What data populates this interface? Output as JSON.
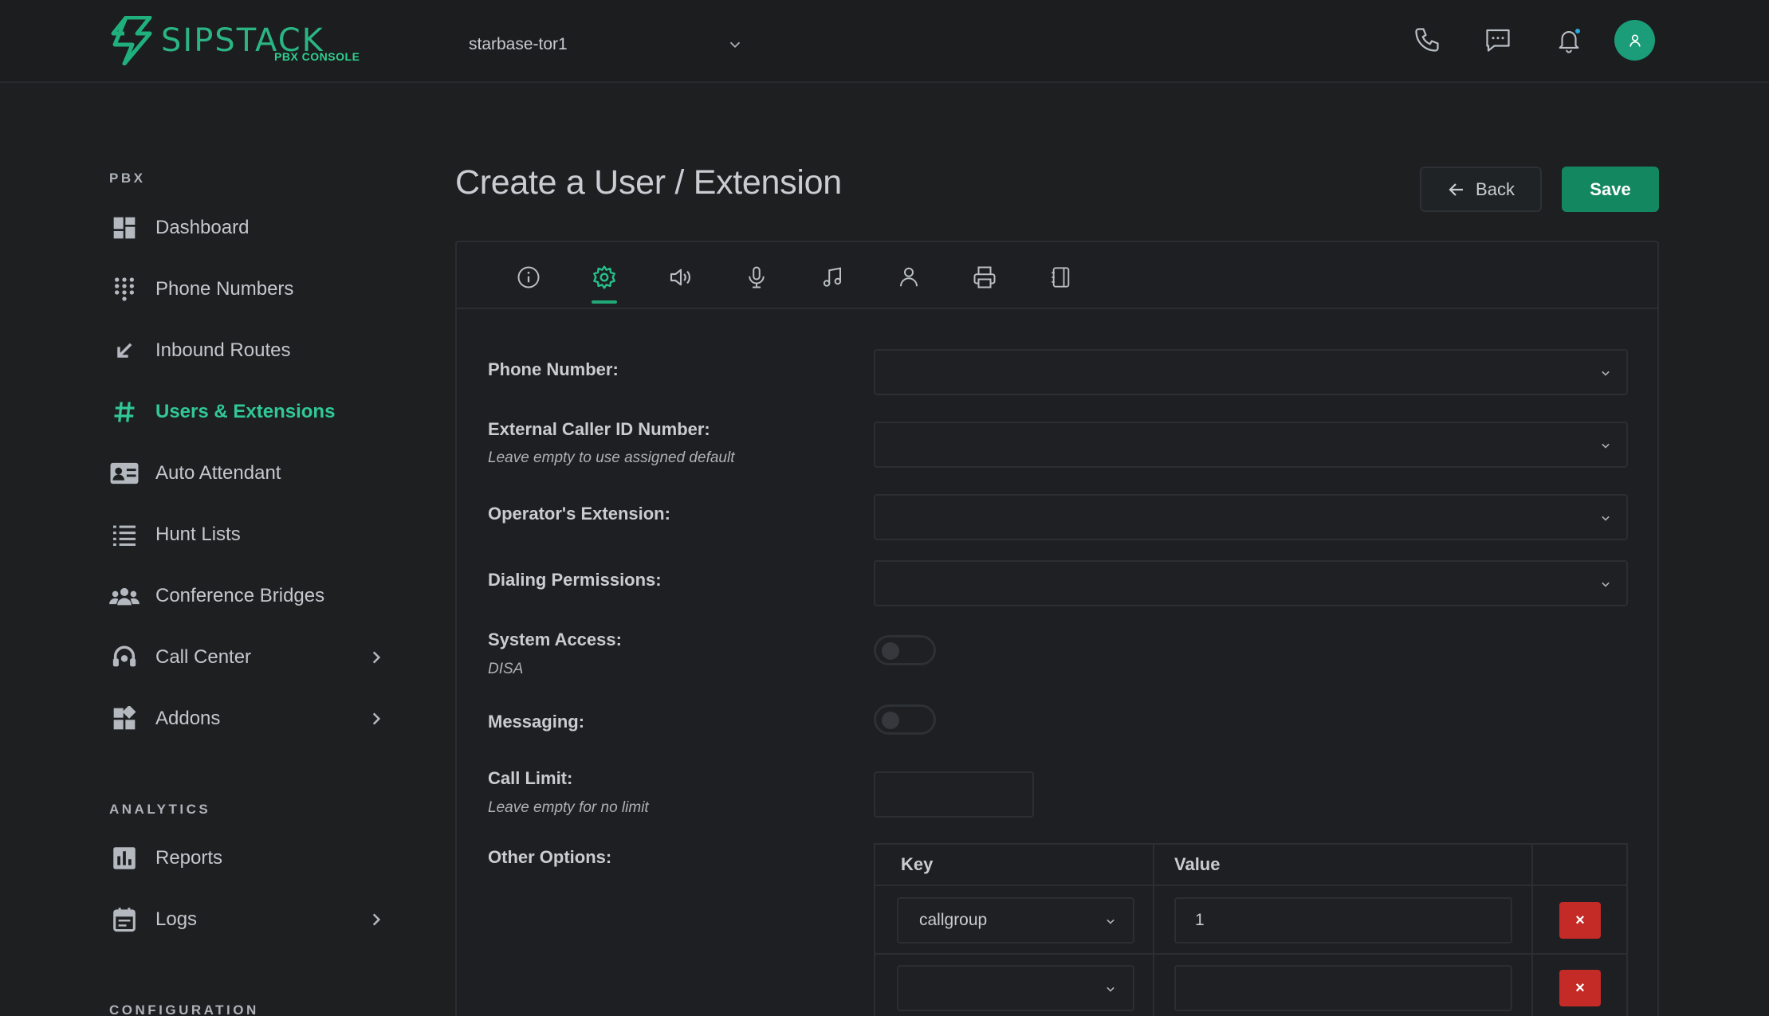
{
  "header": {
    "brand": "SIPSTACK",
    "brand_sub": "PBX CONSOLE",
    "context_selector": "starbase-tor1",
    "icons": [
      "phone-icon",
      "chat-icon",
      "bell-icon",
      "user-icon"
    ],
    "accent": "#1a9d78"
  },
  "sidebar": {
    "sections": [
      {
        "title": "PBX",
        "items": [
          {
            "label": "Dashboard",
            "icon": "dashboard-icon"
          },
          {
            "label": "Phone Numbers",
            "icon": "dialpad-icon"
          },
          {
            "label": "Inbound Routes",
            "icon": "arrow-down-left-icon"
          },
          {
            "label": "Users & Extensions",
            "icon": "hash-icon",
            "active": true
          },
          {
            "label": "Auto Attendant",
            "icon": "contact-card-icon"
          },
          {
            "label": "Hunt Lists",
            "icon": "list-icon"
          },
          {
            "label": "Conference Bridges",
            "icon": "group-icon"
          },
          {
            "label": "Call Center",
            "icon": "headset-icon",
            "expandable": true
          },
          {
            "label": "Addons",
            "icon": "addons-icon",
            "expandable": true
          }
        ]
      },
      {
        "title": "ANALYTICS",
        "items": [
          {
            "label": "Reports",
            "icon": "bar-chart-icon"
          },
          {
            "label": "Logs",
            "icon": "calendar-icon",
            "expandable": true
          }
        ]
      },
      {
        "title": "CONFIGURATION",
        "items": []
      }
    ]
  },
  "main": {
    "title": "Create a User / Extension",
    "back_label": "Back",
    "save_label": "Save",
    "tabs": [
      {
        "icon": "info-icon"
      },
      {
        "icon": "settings-icon",
        "active": true
      },
      {
        "icon": "speaker-icon"
      },
      {
        "icon": "microphone-icon"
      },
      {
        "icon": "music-note-icon"
      },
      {
        "icon": "person-icon"
      },
      {
        "icon": "printer-icon"
      },
      {
        "icon": "phonebook-icon"
      }
    ],
    "fields": {
      "phone_number": {
        "label": "Phone Number:",
        "value": ""
      },
      "external_caller_id": {
        "label": "External Caller ID Number:",
        "hint": "Leave empty to use assigned default",
        "value": ""
      },
      "operator_extension": {
        "label": "Operator's Extension:",
        "value": ""
      },
      "dialing_permissions": {
        "label": "Dialing Permissions:",
        "value": ""
      },
      "system_access": {
        "label": "System Access:",
        "hint": "DISA",
        "enabled": false
      },
      "messaging": {
        "label": "Messaging:",
        "enabled": false
      },
      "call_limit": {
        "label": "Call Limit:",
        "hint": "Leave empty for no limit",
        "value": ""
      },
      "other_options": {
        "label": "Other Options:",
        "columns": [
          "Key",
          "Value",
          ""
        ],
        "rows": [
          {
            "key": "callgroup",
            "value": "1"
          },
          {
            "key": "",
            "value": ""
          }
        ],
        "delete_label": "×"
      }
    }
  }
}
